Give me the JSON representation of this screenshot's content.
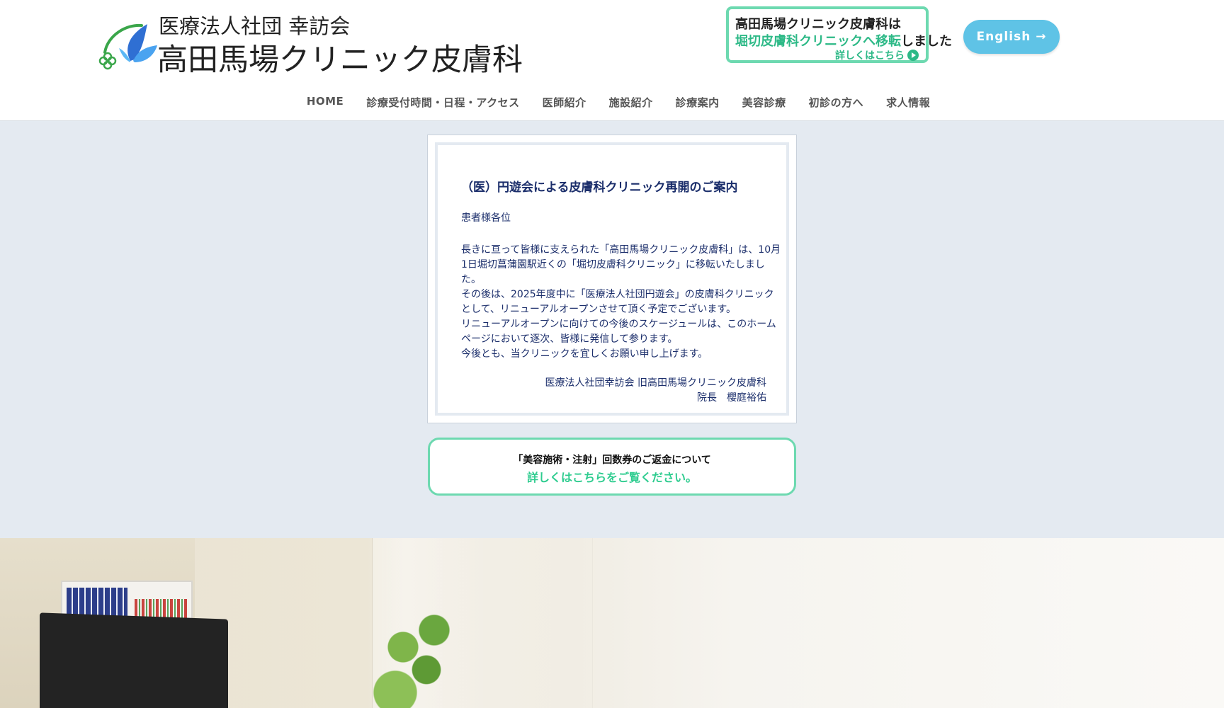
{
  "header": {
    "logo": {
      "org_name": "医療法人社団 幸訪会",
      "clinic_name": "高田馬場クリニック皮膚科"
    },
    "move_banner": {
      "line1": "高田馬場クリニック皮膚科は",
      "line2_highlight": "堀切皮膚科クリニックへ移転",
      "line2_rest": "しました",
      "more": "詳しくはこちら"
    },
    "english_button": "English →"
  },
  "nav": {
    "items": [
      {
        "label": "HOME"
      },
      {
        "label": "診療受付時間・日程・アクセス"
      },
      {
        "label": "医師紹介"
      },
      {
        "label": "施設紹介"
      },
      {
        "label": "診療案内"
      },
      {
        "label": "美容診療"
      },
      {
        "label": "初診の方へ"
      },
      {
        "label": "求人情報"
      }
    ]
  },
  "notice": {
    "title": "（医）円遊会による皮膚科クリニック再開のご案内",
    "greeting": "患者様各位",
    "paragraphs": [
      "長きに亘って皆様に支えられた「高田馬場クリニック皮膚科」は、10月1日堀切菖蒲園駅近くの「堀切皮膚科クリニック」に移転いたしました。",
      "その後は、2025年度中に「医療法人社団円遊会」の皮膚科クリニックとして、リニューアルオープンさせて頂く予定でございます。",
      "リニューアルオープンに向けての今後のスケージュールは、このホームページにおいて逐次、皆様に発信して参ります。",
      "今後とも、当クリニックを宜しくお願い申し上げます。"
    ],
    "signature_org": "医療法人社団幸訪会 旧高田馬場クリニック皮膚科",
    "signature_name": "院長　櫻庭裕佑"
  },
  "refund_notice": {
    "line1": "「美容施術・注射」回数券のご返金について",
    "line2": "詳しくはこちらをご覧ください。"
  },
  "colors": {
    "accent_green": "#6dd9b0",
    "link_green": "#2ecc8f",
    "english_button": "#5fc3e6",
    "notice_text": "#1b2e6b",
    "page_background": "#e4eaf1"
  }
}
